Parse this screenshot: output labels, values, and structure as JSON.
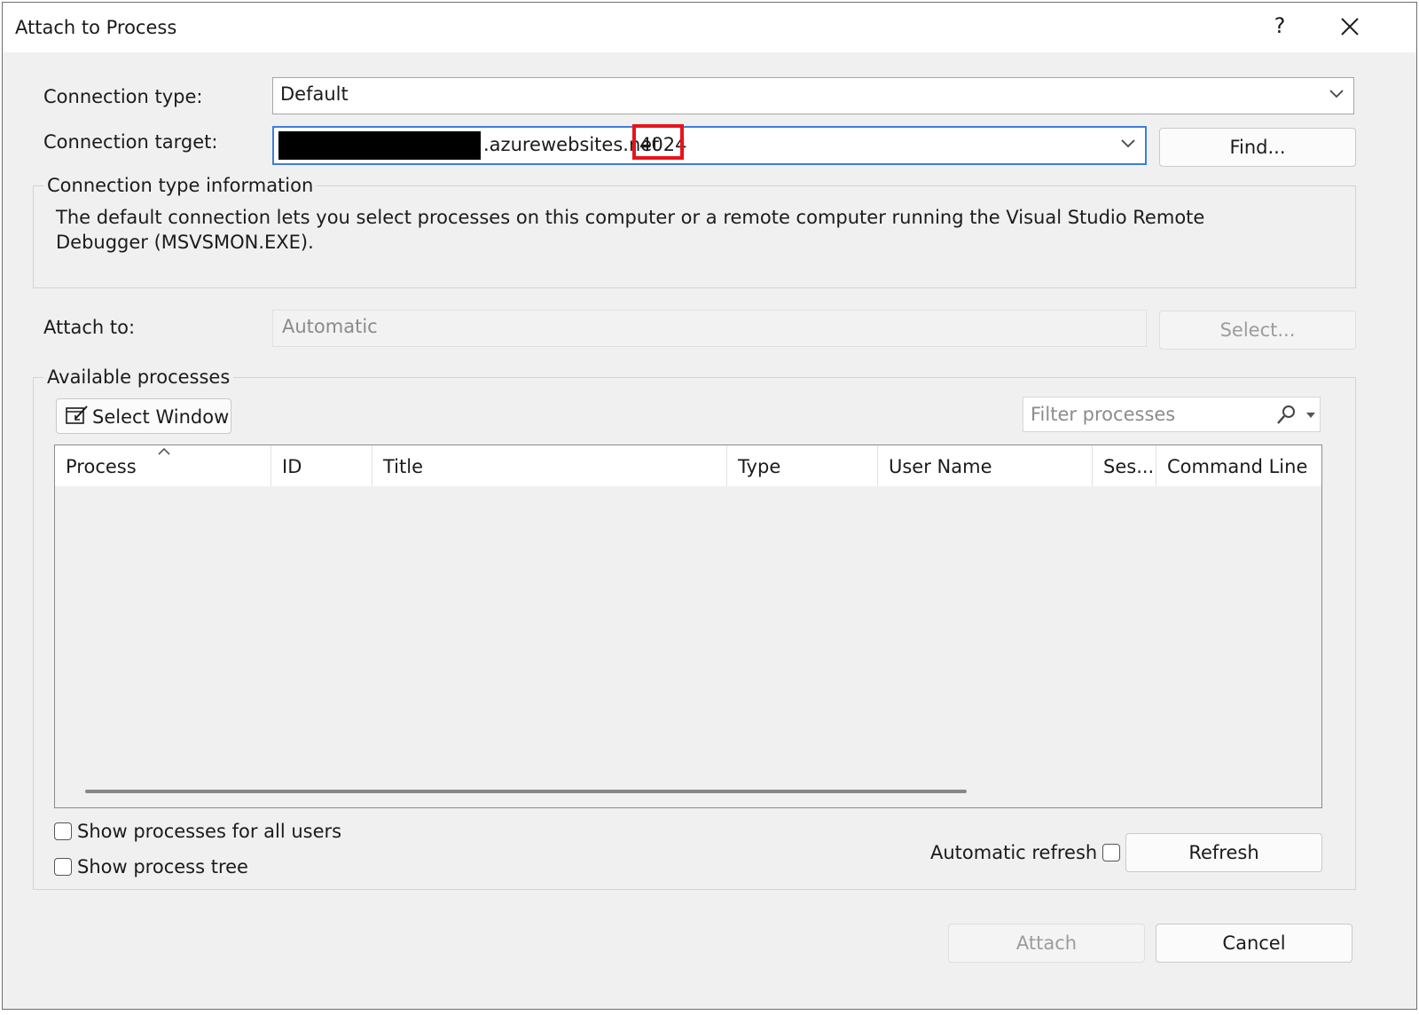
{
  "window": {
    "title": "Attach to Process",
    "help_label": "?",
    "close_icon": "close-icon"
  },
  "connection": {
    "type_label": "Connection type:",
    "type_value": "Default",
    "target_label": "Connection target:",
    "target_value_visible": ".azurewebsites.net",
    "target_port": "4024",
    "find_label": "Find..."
  },
  "info_group": {
    "legend": "Connection type information",
    "text": "The default connection lets you select processes on this computer or a remote computer running the Visual Studio Remote Debugger (MSVSMON.EXE)."
  },
  "attach_to": {
    "label": "Attach to:",
    "value": "Automatic",
    "select_label": "Select..."
  },
  "processes": {
    "legend": "Available processes",
    "select_window_label": "Select Window",
    "filter_placeholder": "Filter processes",
    "columns": [
      "Process",
      "ID",
      "Title",
      "Type",
      "User Name",
      "Ses...",
      "Command Line"
    ],
    "rows": [],
    "show_all_users_label": "Show processes for all users",
    "show_tree_label": "Show process tree",
    "auto_refresh_label": "Automatic refresh",
    "refresh_label": "Refresh"
  },
  "footer": {
    "attach_label": "Attach",
    "cancel_label": "Cancel"
  },
  "colors": {
    "focus_border": "#3f7ed8",
    "highlight_red": "#e8141b",
    "dialog_bg": "#f0f0f0"
  }
}
